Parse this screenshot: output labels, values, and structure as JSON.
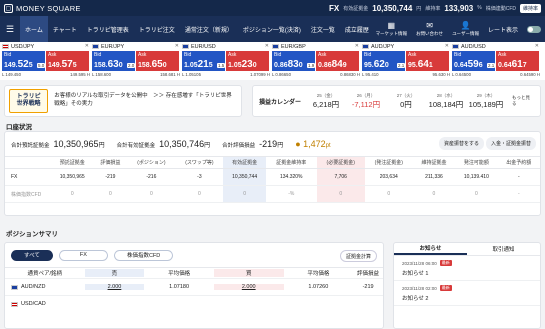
{
  "header": {
    "brand": "MONEY SQUARE",
    "mode": "FX",
    "balance_label": "有効証拠金",
    "balance": "10,350,744",
    "balance_unit": "円",
    "margin_rate_label": "維持率",
    "margin_rate": "133,903",
    "margin_rate_unit": "%",
    "pill": "株価連動CFD",
    "pill2": "維持率"
  },
  "nav": {
    "items": [
      "ホーム",
      "チャート",
      "トラリピ管理表",
      "トラリピ注文",
      "通常注文（新規）",
      "ポジション一覧(決済)",
      "注文一覧",
      "成立履歴"
    ],
    "icons": [
      "マーケット情報",
      "お問い合わせ",
      "ユーザー情報"
    ],
    "rate_display": "レート表示"
  },
  "tickers": [
    {
      "pair": "USD/JPY",
      "flag1": "us",
      "flag2": "jp",
      "bid_label": "Bid",
      "bid_pre": "149.",
      "bid_big": "52",
      "bid_sub": "5",
      "ask_label": "Ask",
      "ask_pre": "149.",
      "ask_big": "57",
      "ask_sub": "5",
      "spread": "5.0",
      "low": "149.450",
      "high": "149.595"
    },
    {
      "pair": "EUR/JPY",
      "flag1": "eu",
      "flag2": "jp",
      "bid_label": "Bid",
      "bid_pre": "158.",
      "bid_big": "63",
      "bid_sub": "0",
      "ask_label": "Ask",
      "ask_pre": "158.",
      "ask_big": "65",
      "ask_sub": "0",
      "spread": "2.0",
      "low": "158.600",
      "high": "158.681"
    },
    {
      "pair": "EUR/USD",
      "flag1": "eu",
      "flag2": "us",
      "bid_label": "Bid",
      "bid_pre": "1.05",
      "bid_big": "21",
      "bid_sub": "5",
      "ask_label": "Ask",
      "ask_pre": "1.05",
      "ask_big": "23",
      "ask_sub": "0",
      "spread": "1.5",
      "low": "1.05105",
      "high": "1.07099"
    },
    {
      "pair": "EUR/GBP",
      "flag1": "eu",
      "flag2": "gb",
      "bid_label": "Bid",
      "bid_pre": "0.86",
      "bid_big": "83",
      "bid_sub": "0",
      "ask_label": "Ask",
      "ask_pre": "0.86",
      "ask_big": "84",
      "ask_sub": "9",
      "spread": "1.9",
      "low": "0.86650",
      "high": "0.86830"
    },
    {
      "pair": "AUD/JPY",
      "flag1": "au",
      "flag2": "jp",
      "bid_label": "Bid",
      "bid_pre": "95.",
      "bid_big": "62",
      "bid_sub": "0",
      "ask_label": "Ask",
      "ask_pre": "95.",
      "ask_big": "64",
      "ask_sub": "1",
      "spread": "2.1",
      "low": "95.410",
      "high": "95.630"
    },
    {
      "pair": "AUD/USD",
      "flag1": "au",
      "flag2": "us",
      "bid_label": "Bid",
      "bid_pre": "0.64",
      "bid_big": "59",
      "bid_sub": "6",
      "ask_label": "Ask",
      "ask_pre": "0.64",
      "ask_big": "61",
      "ask_sub": "7",
      "spread": "2.1",
      "low": "0.64500",
      "high": "0.64590"
    }
  ],
  "banner": {
    "badge_line1": "トラリピ",
    "badge_line2": "世界戦略",
    "text1": "お客様のリアルな取引データを公開中　＞＞ 存在感増す「トラリピ世界戦略」その実力"
  },
  "calendar": {
    "title": "損益カレンダー",
    "days": [
      {
        "d": "25（金）",
        "v": "6,218",
        "u": "円"
      },
      {
        "d": "26（月）",
        "v": "-7,112",
        "u": "円"
      },
      {
        "d": "27（火）",
        "v": "0",
        "u": "円"
      },
      {
        "d": "28（水）",
        "v": "108,184",
        "u": "円"
      },
      {
        "d": "29（木）",
        "v": "105,189",
        "u": "円"
      }
    ],
    "more": "もっと見る"
  },
  "account": {
    "title": "口座状況",
    "sums": [
      {
        "l": "合計預託証拠金",
        "v": "10,350,965",
        "u": "円"
      },
      {
        "l": "合計有効証拠金",
        "v": "10,350,746",
        "u": "円"
      },
      {
        "l": "合計評価損益",
        "v": "-219",
        "u": "円"
      },
      {
        "l": "",
        "v": "1,472",
        "u": "pt"
      }
    ],
    "btn1": "資産振替をする",
    "btn2": "入金・証拠金振替",
    "headers": [
      "",
      "預託証拠金",
      "評価損益",
      "(ポジション)",
      "(スワップ等)",
      "有効証拠金",
      "証拠金維持率",
      "(必要証拠金)",
      "(発注証拠金)",
      "維持証拠金",
      "発注可能額",
      "出金予約額"
    ],
    "rows": [
      [
        "FX",
        "10,350,965",
        "-219",
        "-216",
        "-3",
        "10,350,744",
        "134.320%",
        "7,706",
        "203,634",
        "211,336",
        "10,139.410",
        "-"
      ],
      [
        "株価指数CFD",
        "0",
        "0",
        "0",
        "0",
        "0",
        "-%",
        "0",
        "0",
        "0",
        "0",
        "-"
      ]
    ]
  },
  "positions": {
    "title": "ポジションサマリ",
    "chips": [
      "すべて",
      "FX",
      "株価指数CFD"
    ],
    "settle": "証拠金計算",
    "headers": [
      "通貨ペア/銘柄",
      "売",
      "平均価格",
      "買",
      "平均価格",
      "評価損益"
    ],
    "rows": [
      {
        "pair": "AUD/NZD",
        "flag": "au",
        "sell": "2.000",
        "sell_avg": "1.07180",
        "buy": "2.000",
        "buy_avg": "1.07260",
        "pl": "-219"
      },
      {
        "pair": "USD/CAD",
        "flag": "us",
        "sell": "",
        "sell_avg": "",
        "buy": "",
        "buy_avg": "",
        "pl": ""
      }
    ]
  },
  "news": {
    "tabs": [
      "お知らせ",
      "取引通知"
    ],
    "items": [
      {
        "date": "2023/11/28 06:00",
        "tag": "最新",
        "title": "お知らせ 1"
      },
      {
        "date": "2023/11/28 02:00",
        "tag": "最新",
        "title": "お知らせ 2"
      }
    ]
  },
  "colors": {
    "navy": "#14284a",
    "bid": "#2255c4",
    "ask": "#d83a3a"
  }
}
